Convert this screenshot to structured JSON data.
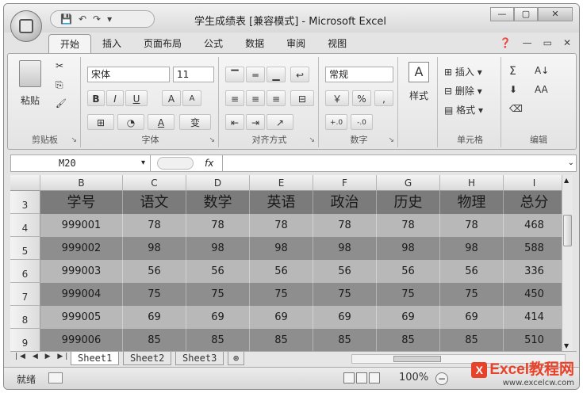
{
  "window": {
    "title": "学生成绩表 [兼容模式] - Microsoft Excel",
    "qat_icons": [
      "save-icon",
      "undo-icon",
      "redo-icon",
      "customize-icon"
    ],
    "min_label": "—",
    "max_label": "▢",
    "close_label": "✕"
  },
  "tabs": [
    "开始",
    "插入",
    "页面布局",
    "公式",
    "数据",
    "审阅",
    "视图"
  ],
  "tab_right": {
    "help": "❓",
    "min": "—",
    "restore": "▭",
    "close": "✕"
  },
  "ribbon": {
    "clipboard": {
      "label": "剪贴板",
      "paste": "粘贴",
      "cut": "✂",
      "copy": "⎘",
      "format_painter": "🖌"
    },
    "font": {
      "label": "字体",
      "name": "宋体",
      "size": "11",
      "bold": "B",
      "italic": "I",
      "underline": "U",
      "grow": "A",
      "shrink": "A",
      "border": "⊞",
      "fill": "◔",
      "color": "A",
      "phonetic": "变"
    },
    "alignment": {
      "label": "对齐方式"
    },
    "number": {
      "label": "数字",
      "format": "常规",
      "currency": "￥",
      "percent": "%",
      "comma": ",",
      "inc": "+.0",
      "dec": "-.0"
    },
    "styles": {
      "label": "样式"
    },
    "cells": {
      "label": "单元格",
      "insert": "插入",
      "delete": "删除",
      "format": "格式"
    },
    "editing": {
      "label": "编辑",
      "sum": "Σ",
      "sort": "A↓",
      "find": "AA"
    }
  },
  "formula_bar": {
    "name_box": "M20",
    "fx": "fx",
    "value": ""
  },
  "columns": [
    "B",
    "C",
    "D",
    "E",
    "F",
    "G",
    "H",
    "I"
  ],
  "rows": [
    {
      "num": "3",
      "cells": [
        "学号",
        "语文",
        "数学",
        "英语",
        "政治",
        "历史",
        "物理",
        "总分"
      ]
    },
    {
      "num": "4",
      "cells": [
        "999001",
        "78",
        "78",
        "78",
        "78",
        "78",
        "78",
        "468"
      ]
    },
    {
      "num": "5",
      "cells": [
        "999002",
        "98",
        "98",
        "98",
        "98",
        "98",
        "98",
        "588"
      ]
    },
    {
      "num": "6",
      "cells": [
        "999003",
        "56",
        "56",
        "56",
        "56",
        "56",
        "56",
        "336"
      ]
    },
    {
      "num": "7",
      "cells": [
        "999004",
        "75",
        "75",
        "75",
        "75",
        "75",
        "75",
        "450"
      ]
    },
    {
      "num": "8",
      "cells": [
        "999005",
        "69",
        "69",
        "69",
        "69",
        "69",
        "69",
        "414"
      ]
    },
    {
      "num": "9",
      "cells": [
        "999006",
        "85",
        "85",
        "85",
        "85",
        "85",
        "85",
        "510"
      ]
    }
  ],
  "sheets": [
    "Sheet1",
    "Sheet2",
    "Sheet3"
  ],
  "status": {
    "ready": "就绪",
    "zoom": "100%"
  },
  "watermark": {
    "brand": "Excel教程网",
    "url": "www.excelcw.com"
  },
  "colors": {
    "header_row": "#7b7b7b",
    "row_light": "#b8b8b8",
    "row_dark": "#8e8e8e"
  }
}
